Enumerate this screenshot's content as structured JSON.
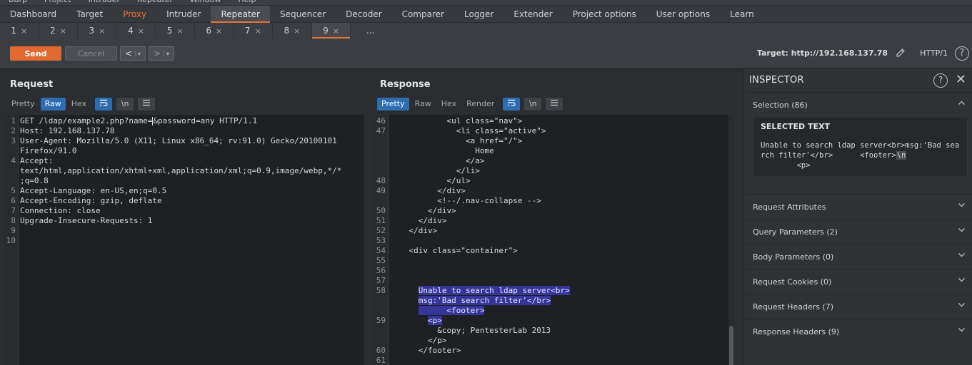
{
  "menubar": [
    "Burp",
    "Project",
    "Intruder",
    "Repeater",
    "Window",
    "Help"
  ],
  "main_tabs": [
    "Dashboard",
    "Target",
    "Proxy",
    "Intruder",
    "Repeater",
    "Sequencer",
    "Decoder",
    "Comparer",
    "Logger",
    "Extender",
    "Project options",
    "User options",
    "Learn"
  ],
  "repeater_tabs": [
    "1",
    "2",
    "3",
    "4",
    "5",
    "6",
    "7",
    "8",
    "9"
  ],
  "repeater_more": "...",
  "tab_close": "×",
  "toolbar": {
    "send": "Send",
    "cancel": "Cancel",
    "back": "<",
    "forward": ">",
    "dropdown": "▾",
    "target": "Target: http://192.168.137.78",
    "http_version": "HTTP/1",
    "help": "?"
  },
  "request": {
    "title": "Request",
    "tabs": [
      "Pretty",
      "Raw",
      "Hex"
    ],
    "newline_toggle": "\\n",
    "lines": [
      {
        "n": "1",
        "text": "GET /ldap/example2.php?name=",
        "cont": "&password=any HTTP/1.1"
      },
      {
        "n": "2",
        "text": "Host: 192.168.137.78"
      },
      {
        "n": "3",
        "text": "User-Agent: Mozilla/5.0 (X11; Linux x86_64; rv:91.0) Gecko/20100101"
      },
      {
        "n": "",
        "text": "Firefox/91.0"
      },
      {
        "n": "4",
        "text": "Accept:"
      },
      {
        "n": "",
        "text": "text/html,application/xhtml+xml,application/xml;q=0.9,image/webp,*/*"
      },
      {
        "n": "",
        "text": ";q=0.8"
      },
      {
        "n": "5",
        "text": "Accept-Language: en-US,en;q=0.5"
      },
      {
        "n": "6",
        "text": "Accept-Encoding: gzip, deflate"
      },
      {
        "n": "7",
        "text": "Connection: close"
      },
      {
        "n": "8",
        "text": "Upgrade-Insecure-Requests: 1"
      },
      {
        "n": "9",
        "text": ""
      },
      {
        "n": "10",
        "text": ""
      }
    ]
  },
  "response": {
    "title": "Response",
    "tabs": [
      "Pretty",
      "Raw",
      "Hex",
      "Render"
    ],
    "newline_toggle": "\\n",
    "lines": [
      {
        "n": "46",
        "text": "            <ul class=\"nav\">",
        "hl": false
      },
      {
        "n": "47",
        "text": "              <li class=\"active\">",
        "hl": false
      },
      {
        "n": "",
        "text": "                <a href=\"/\">",
        "hl": false
      },
      {
        "n": "",
        "text": "                  Home",
        "hl": false
      },
      {
        "n": "",
        "text": "                </a>",
        "hl": false
      },
      {
        "n": "",
        "text": "              </li>",
        "hl": false
      },
      {
        "n": "48",
        "text": "            </ul>",
        "hl": false
      },
      {
        "n": "49",
        "text": "          </div>",
        "hl": false
      },
      {
        "n": "",
        "text": "          <!--/.nav-collapse -->",
        "hl": false
      },
      {
        "n": "50",
        "text": "        </div>",
        "hl": false
      },
      {
        "n": "51",
        "text": "      </div>",
        "hl": false
      },
      {
        "n": "52",
        "text": "    </div>",
        "hl": false
      },
      {
        "n": "53",
        "text": "",
        "hl": false
      },
      {
        "n": "54",
        "text": "    <div class=\"container\">",
        "hl": false
      },
      {
        "n": "55",
        "text": "",
        "hl": false
      },
      {
        "n": "56",
        "text": "",
        "hl": false
      },
      {
        "n": "57",
        "text": "",
        "hl": false
      },
      {
        "n": "58",
        "text": "Unable to search ldap server<br>",
        "hl": true,
        "indent": "      "
      },
      {
        "n": "",
        "text": "msg:'Bad search filter'</br>",
        "hl": true,
        "indent": "      "
      },
      {
        "n": "",
        "text": "      <footer>",
        "hl": true,
        "indent": "      "
      },
      {
        "n": "59",
        "text": "<p>",
        "hl": true,
        "indent": "        "
      },
      {
        "n": "",
        "text": "          &copy; PentesterLab 2013",
        "hl": false
      },
      {
        "n": "",
        "text": "        </p>",
        "hl": false
      },
      {
        "n": "60",
        "text": "      </footer>",
        "hl": false
      },
      {
        "n": "61",
        "text": "",
        "hl": false
      }
    ]
  },
  "inspector": {
    "title": "INSPECTOR",
    "selection_label": "Selection (86)",
    "selected_text_head": "SELECTED TEXT",
    "selected_text": "Unable to search ldap server<br>msg:'Bad search filter'</br>      <footer>",
    "selected_nl": "\\n",
    "selected_tail": "        <p>",
    "sections": [
      "Request Attributes",
      "Query Parameters (2)",
      "Body Parameters (0)",
      "Request Cookies (0)",
      "Request Headers (7)",
      "Response Headers (9)"
    ]
  },
  "icons": {
    "wrap": "wrap-icon",
    "menu": "hamburger-icon",
    "edit": "pencil-icon",
    "close": "close-icon",
    "chevron": "chevron-down-icon"
  }
}
